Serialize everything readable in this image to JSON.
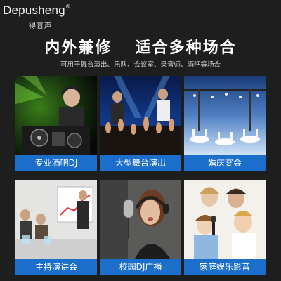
{
  "brand": {
    "name": "Depusheng",
    "registered_mark": "®",
    "subtitle": "得普声"
  },
  "headline": {
    "part1": "内外兼修",
    "part2": "适合多种场合"
  },
  "subline": "可用于舞台演出、乐队、会议室、录音师、酒吧等场合",
  "scenes": [
    {
      "label": "专业酒吧DJ"
    },
    {
      "label": "大型舞台演出"
    },
    {
      "label": "婚庆宴会"
    },
    {
      "label": "主持演讲会"
    },
    {
      "label": "校园DJ广播"
    },
    {
      "label": "家庭娱乐影音"
    }
  ],
  "colors": {
    "background": "#1e1e1e",
    "label_bar": "#1b6ec9",
    "text": "#ffffff"
  }
}
